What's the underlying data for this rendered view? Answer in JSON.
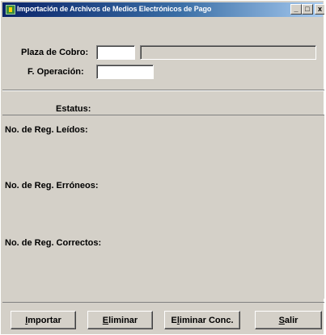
{
  "window": {
    "title": "Importación de Archivos de Medios Electrónicos de Pago",
    "min_glyph": "_",
    "max_glyph": "□",
    "close_glyph": "x"
  },
  "form": {
    "plaza_label": "Plaza de Cobro:",
    "plaza_code": "",
    "plaza_name": "",
    "operacion_label": "F. Operación:",
    "operacion_value": ""
  },
  "status": {
    "estatus_label": "Estatus:",
    "leidos_label": "No. de Reg. Leídos:",
    "erroneos_label": "No. de Reg. Erróneos:",
    "correctos_label": "No. de Reg. Correctos:"
  },
  "buttons": {
    "importar": {
      "accel": "I",
      "rest": "mportar"
    },
    "eliminar": {
      "accel": "E",
      "rest": "liminar"
    },
    "eliminar_conc": {
      "pre": "E",
      "accel": "l",
      "rest": "iminar Conc."
    },
    "salir": {
      "accel": "S",
      "rest": "alir"
    }
  }
}
